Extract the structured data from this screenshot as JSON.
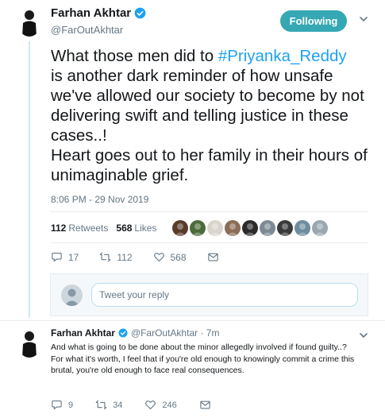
{
  "tweet": {
    "author_name": "Farhan Akhtar",
    "author_handle": "@FarOutAkhtar",
    "follow_label": "Following",
    "text_before_hashtag": "What those men did to ",
    "hashtag": "#Priyanka_Reddy",
    "text_after_hashtag": "\nis another dark reminder of how unsafe we've allowed our society to become by not delivering swift and telling justice in these cases..!\nHeart goes out to her family in their hours of unimaginable grief.",
    "timestamp": "8:06 PM - 29 Nov 2019",
    "retweets_count": "112",
    "retweets_label": "Retweets",
    "likes_count": "568",
    "likes_label": "Likes",
    "liker_avatars": [
      "#5a3b2a",
      "#4b6b3a",
      "#d9d4cc",
      "#8a6d55",
      "#2b2b2b",
      "#7c8a96",
      "#3a3a3a",
      "#6d8d9e",
      "#9aa7b1"
    ],
    "actions": {
      "reply_count": "17",
      "retweet_count": "112",
      "like_count": "568"
    }
  },
  "reply_box": {
    "placeholder": "Tweet your reply"
  },
  "reply_tweet": {
    "author_name": "Farhan Akhtar",
    "meta": "@FarOutAkhtar · 7m",
    "text": "And what is going to be done about the minor allegedly involved if found guilty..?\nFor what it's worth, I feel that if you're old enough to knowingly commit a crime this brutal, you're old enough to face real consequences.",
    "actions": {
      "reply_count": "9",
      "retweet_count": "34",
      "like_count": "246"
    }
  },
  "colors": {
    "accent": "#1da1f2",
    "follow_button": "#35a8b4",
    "muted_text": "#657786"
  }
}
